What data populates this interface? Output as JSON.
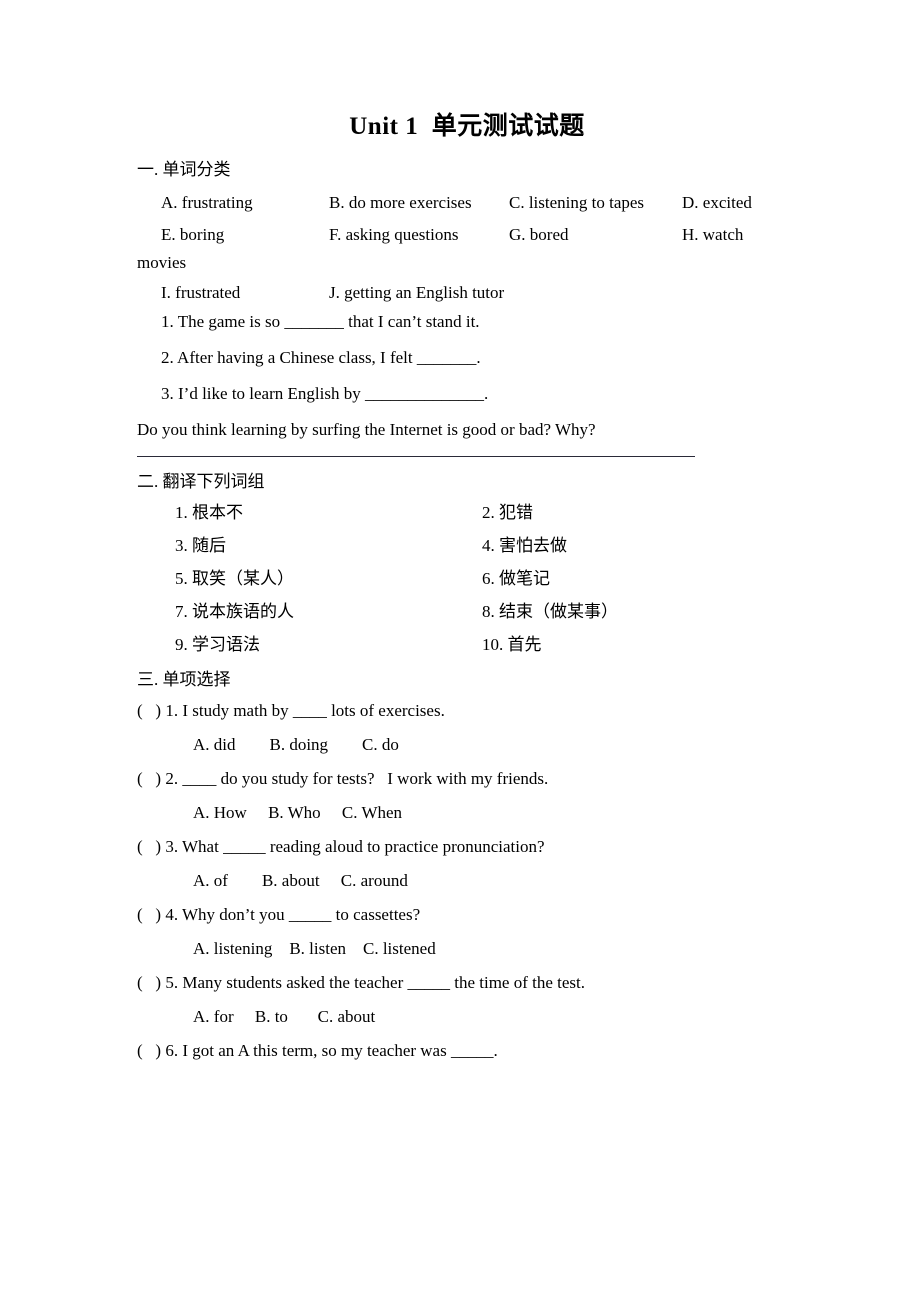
{
  "document": {
    "title": "Unit 1  单元测试试题"
  },
  "section1": {
    "heading": "一. 单词分类",
    "wordbank": {
      "row1": {
        "a": "A. frustrating",
        "b": "B. do more exercises",
        "c": "C. listening to tapes",
        "d": "D. excited"
      },
      "row2": {
        "e": "E. boring",
        "f": "F. asking questions",
        "g": "G. bored",
        "h": "H. watch"
      },
      "row2_wrap": "movies",
      "row3": {
        "i": "I. frustrated",
        "j": "J. getting an English tutor"
      }
    },
    "fill_items": [
      "1. The game is so _______ that I can’t stand it.",
      "2. After having a Chinese class, I felt _______.",
      "3. I’d like to learn English by ______________."
    ],
    "free_question": "Do you think learning by surfing the Internet is good or bad? Why?"
  },
  "section2": {
    "heading": "二. 翻译下列词组",
    "rows": [
      {
        "left": "1. 根本不",
        "right": "2. 犯错"
      },
      {
        "left": "3. 随后",
        "right": "4. 害怕去做"
      },
      {
        "left": "5. 取笑（某人）",
        "right": "6. 做笔记"
      },
      {
        "left": "7. 说本族语的人",
        "right": "8. 结束（做某事）"
      },
      {
        "left": "9. 学习语法",
        "right": "10.  首先"
      }
    ]
  },
  "section3": {
    "heading": "三. 单项选择",
    "questions": [
      {
        "stem": "(   ) 1. I study math by ____ lots of exercises.",
        "options": "A. did        B. doing        C. do"
      },
      {
        "stem": "(   ) 2. ____ do you study for tests?   I work with my friends.",
        "options": "A. How     B. Who     C. When"
      },
      {
        "stem": "(   ) 3. What _____ reading aloud to practice pronunciation?",
        "options": "A. of        B. about     C. around"
      },
      {
        "stem": "(   ) 4. Why don’t you _____ to cassettes?",
        "options": "A. listening    B. listen    C. listened"
      },
      {
        "stem": "(   ) 5. Many students asked the teacher _____ the time of the test.",
        "options": "A. for     B. to       C. about"
      },
      {
        "stem": "(   ) 6. I got an A this term, so my teacher was _____.",
        "options": ""
      }
    ]
  }
}
